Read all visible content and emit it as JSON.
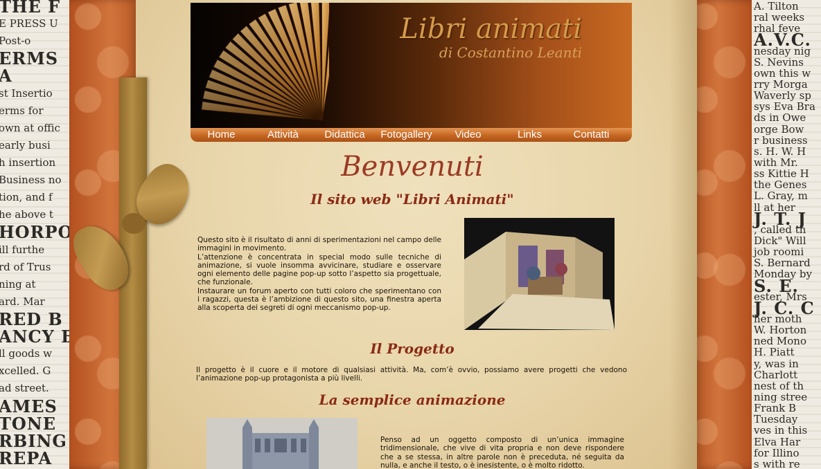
{
  "site": {
    "title": "Libri animati",
    "subtitle": "di Costantino Leanti"
  },
  "nav": {
    "items": [
      "Home",
      "Attività",
      "Didattica",
      "Fotogallery",
      "Video",
      "Links",
      "Contatti"
    ]
  },
  "content": {
    "welcome_title": "Benvenuti",
    "site_section_title": "Il sito web \"Libri Animati\"",
    "intro_paragraphs": [
      "Questo sito è il risultato di anni di sperimentazioni nel campo delle immagini in movimento.",
      "L’attenzione è concentrata in special modo sulle tecniche di animazione, si vuole insomma avvicinare, studiare e osservare ogni elemento delle pagine pop-up sotto l’aspetto sia progettuale, che funzionale.",
      "Instaurare un forum aperto con tutti coloro che sperimentano con i ragazzi, questa è l’ambizione di questo sito, una finestra aperta alla scoperta dei segreti di ogni meccanismo pop-up."
    ],
    "project_title": "Il Progetto",
    "project_text": "Il progetto è il cuore e il motore di qualsiasi attività. Ma, com’è ovvio, possiamo avere progetti che vedono l’animazione pop-up protagonista a più livelli.",
    "animation_title": "La semplice animazione",
    "animation_text": "Penso ad un oggetto composto di un’unica immagine tridimensionale, che vive di vita propria e non deve rispondere che a se stessa, in altre parole non è preceduta, né seguita da nulla, e anche il testo, o è inesistente, o è molto ridotto."
  },
  "newspaper_left": [
    "THE F",
    "E PRESS U",
    "Post-o",
    "ERMS",
    "A",
    "st Insertio",
    "erms for",
    "own at offic",
    "early busi",
    "h insertion",
    "Business no",
    "tion, and f",
    "he above t",
    "HORPO",
    "ill furthe",
    "rd of Trus",
    "ning at",
    "ard. Mar",
    "RED B",
    "ANCY B",
    "ll goods w",
    "xcelled. G",
    "ad street.",
    "AMES",
    "TONE",
    "RBING A",
    "REPA"
  ],
  "newspaper_right": [
    "A. Tilton",
    "ral weeks",
    "rhal feve",
    "A.V.C.",
    "nesday nig",
    "S. Nevins",
    "own this w",
    "rry Morga",
    "Waverly sp",
    "sys Eva Bra",
    "ds in Owe",
    "orge Bow",
    "r business",
    "s. H. W. H",
    "with Mr.",
    "ss Kittie H",
    "the Genes",
    "L. Gray, m",
    "ll at her",
    "J. T. J",
    ", called th",
    "Dick\" Will",
    "job roomi",
    "S. Bernard",
    "Monday by",
    "S. E.",
    "ester, Mrs",
    "J. C. C",
    "her moth",
    "W. Horton",
    "ned Mono",
    "H. Piatt",
    "y, was in",
    "Charlott",
    "nest of th",
    "ning stree",
    "Frank B",
    "Tuesday",
    "ves in this",
    "Elva Har",
    "for Illino",
    "s with re"
  ]
}
